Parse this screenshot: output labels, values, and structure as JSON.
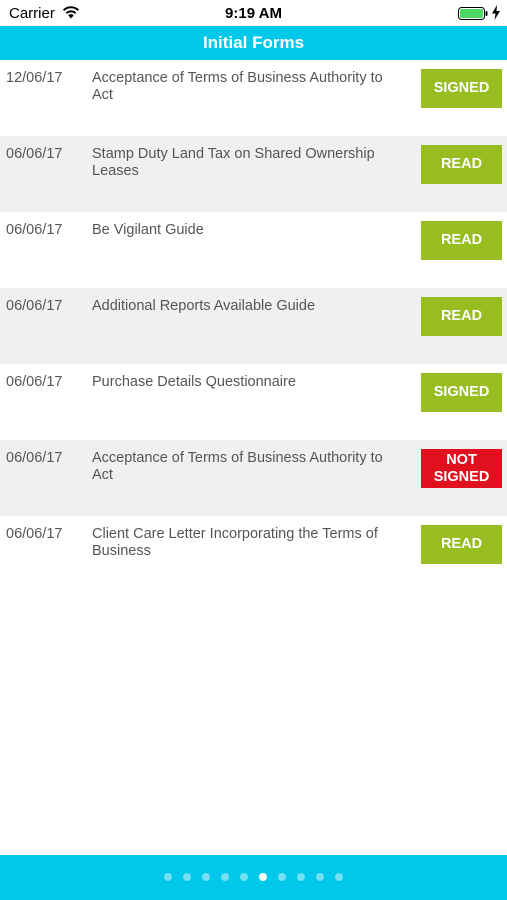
{
  "colors": {
    "accent": "#00c8e8",
    "green": "#97bd21",
    "red": "#e0101e"
  },
  "status_bar": {
    "carrier": "Carrier",
    "time": "9:19 AM",
    "icons": [
      "wifi-icon",
      "battery-icon",
      "charging-bolt-icon"
    ]
  },
  "nav": {
    "title": "Initial Forms"
  },
  "forms": [
    {
      "date": "12/06/17",
      "title": "Acceptance of Terms of Business Authority to Act",
      "status": "SIGNED",
      "kind": "signed"
    },
    {
      "date": "06/06/17",
      "title": "Stamp Duty Land Tax on Shared Ownership Leases",
      "status": "READ",
      "kind": "read"
    },
    {
      "date": "06/06/17",
      "title": "Be Vigilant Guide",
      "status": "READ",
      "kind": "read"
    },
    {
      "date": "06/06/17",
      "title": "Additional Reports Available Guide",
      "status": "READ",
      "kind": "read"
    },
    {
      "date": "06/06/17",
      "title": "Purchase Details Questionnaire",
      "status": "SIGNED",
      "kind": "signed"
    },
    {
      "date": "06/06/17",
      "title": "Acceptance of Terms of Business Authority to Act",
      "status": "NOT SIGNED",
      "kind": "not-signed"
    },
    {
      "date": "06/06/17",
      "title": "Client Care Letter Incorporating the Terms of Business",
      "status": "READ",
      "kind": "read"
    }
  ],
  "pager": {
    "total": 10,
    "active_index": 5
  }
}
